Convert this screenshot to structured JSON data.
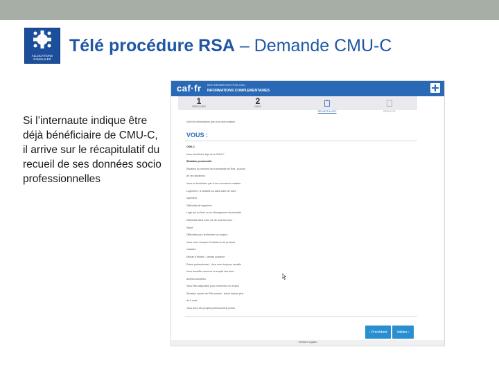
{
  "slide": {
    "title_bold": "Télé procédure RSA",
    "title_rest": " – Demande CMU-C",
    "description": "Si l’internaute indique être déjà bénéficiaire de CMU-C, il arrive sur le récapitulatif  du recueil de ses données socio professionnelles",
    "logo_text_line1": "ALLOCATIONS",
    "logo_text_line2": "FAMILIALES",
    "colors": {
      "title": "#1f57a6",
      "caf_blue": "#2a69b5",
      "button_blue": "#2a8fd0",
      "topbar": "#a6aea6"
    }
  },
  "screenshot": {
    "header_logo": "caf·fr",
    "header_sub1": "MES DEMARCHES RSA CMU",
    "header_sub2": "INFORMATIONS COMPLEMENTAIRES",
    "steps": [
      {
        "num": "1",
        "label": "PARCOURS"
      },
      {
        "num": "2",
        "label": "CMUC"
      },
      {
        "icon": "clipboard-icon",
        "label": "RECAPITULATIF"
      },
      {
        "icon": "doc-icon",
        "label": "RESULTAT"
      }
    ],
    "intro": "Voici les informations que vous avez saisies :",
    "vous": "VOUS :",
    "lines": [
      {
        "text": "CMU-C",
        "bold": true
      },
      {
        "text": "Vous bénéficiez déjà de la CMU-C",
        "bold": false
      },
      {
        "text": "Situation personnelle",
        "bold": true
      },
      {
        "text": "Situation au moment de la demande de Rsa : Aucune",
        "bold": false
      },
      {
        "text": "de ces situations",
        "bold": false
      },
      {
        "text": "Vous ne bénéficiez pas d'une couverture maladie",
        "bold": false
      },
      {
        "text": "Logement : à certaine ou dans votre de votre",
        "bold": false
      },
      {
        "text": "logement",
        "bold": false
      },
      {
        "text": "Difficultés de logement :",
        "bold": false
      },
      {
        "text": "Logé par un tiers ou un hébergement de précarité",
        "bold": false
      },
      {
        "text": "Difficultés dans votre vie de tous les jours :",
        "bold": false
      },
      {
        "text": "Santé",
        "bold": false
      },
      {
        "text": "Difficultés pour rechercher un emploi :",
        "bold": false
      },
      {
        "text": "Vous vous occupez d'enfants ou de proches",
        "bold": false
      },
      {
        "text": "malades",
        "bold": false
      },
      {
        "text": "Niveau d'études : Jamais scolarisé",
        "bold": false
      },
      {
        "text": "Passé professionnel : Vous avez toujours travaillé",
        "bold": false
      },
      {
        "text": "Vous travaillez souvent en emploi des deux",
        "bold": false
      },
      {
        "text": "années dernières",
        "bold": false
      },
      {
        "text": "Vous êtes disponible pour rechercher un emploi",
        "bold": false
      },
      {
        "text": "Situation auprès de Pôle emploi : inscrit depuis plus",
        "bold": false
      },
      {
        "text": "de 6 mois",
        "bold": false
      },
      {
        "text": "Vous avez des projets professionnels précis",
        "bold": false
      }
    ],
    "btn_prev": "‹  Précédent",
    "btn_next": "Valider  ›",
    "footer": "Mentions légales"
  }
}
